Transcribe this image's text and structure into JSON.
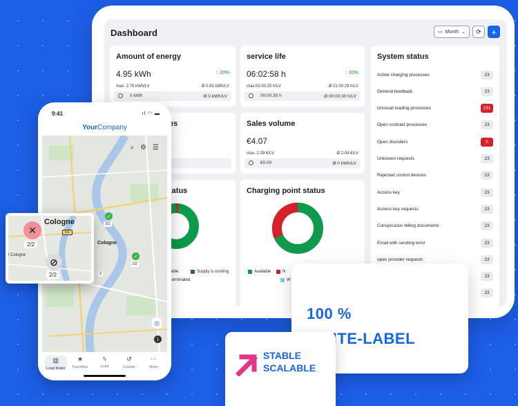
{
  "dashboard": {
    "title": "Dashboard",
    "period_label": "Month",
    "cards": {
      "energy": {
        "title": "Amount of energy",
        "value": "4.95 kWh",
        "delta": "↑ 20%",
        "max": "max. 2.76 kWh/LV",
        "avg": "Ø 0.83 kWh/LV",
        "foot_left": "0 kWh",
        "foot_right": "Ø 0 kWh/LV"
      },
      "service": {
        "title": "service life",
        "value": "06:02:58 h",
        "delta": "↑ 20%",
        "max": "max.03:00:25 h/LV",
        "avg": "Ø 01:00:29 h/LV",
        "foot_left": "00:00:30 h",
        "foot_right": "Ø 00:00:30 h/LV"
      },
      "sessions": {
        "title_partial": "es"
      },
      "sales": {
        "title": "Sales volume",
        "value": "€4.07",
        "max": "max. 2.09 €/LV",
        "avg": "Ø 2.04 €/LV",
        "foot_left": "€0.00",
        "foot_right": "Ø 0 kWh/LV"
      },
      "supply": {
        "title_partial": "tatus",
        "legend": [
          "able",
          "Supply is running",
          "terminated"
        ]
      },
      "charging_point": {
        "title": "Charging point status",
        "legend": [
          "Available",
          "N",
          "W"
        ]
      }
    },
    "system_status": {
      "title": "System status",
      "rows": [
        {
          "label": "Active charging processes",
          "count": "23",
          "alert": false
        },
        {
          "label": "General feedback",
          "count": "23",
          "alert": false
        },
        {
          "label": "Unusual loading processes",
          "count": "231",
          "alert": true
        },
        {
          "label": "Open contract processes",
          "count": "23",
          "alert": false
        },
        {
          "label": "Open disorders",
          "count": "5",
          "alert": true
        },
        {
          "label": "Unknown requests",
          "count": "23",
          "alert": false
        },
        {
          "label": "Rejected control devices",
          "count": "23",
          "alert": false
        },
        {
          "label": "Access key",
          "count": "23",
          "alert": false
        },
        {
          "label": "Access key requests",
          "count": "23",
          "alert": false
        },
        {
          "label": "Conspicuous billing documents",
          "count": "23",
          "alert": false
        },
        {
          "label": "Email with sending error",
          "count": "23",
          "alert": false
        },
        {
          "label": "open provider requests",
          "count": "23",
          "alert": false
        },
        {
          "label": "",
          "count": "23",
          "alert": false
        },
        {
          "label": "",
          "count": "23",
          "alert": false
        }
      ]
    }
  },
  "phone": {
    "time": "9:41",
    "brand_bold": "Your",
    "brand_rest": "Company",
    "map_labels": [
      "2/2",
      "2/2",
      "2",
      "Cologne"
    ],
    "nav": [
      "Load finder",
      "Favorites",
      "Load",
      "Courier",
      "More"
    ]
  },
  "zoom": {
    "city": "Cologne",
    "side_label": "l Cologne",
    "badge_top": "51",
    "pin1_label": "2/2",
    "pin2_label": "2/2"
  },
  "badges": {
    "white_label_1": "100 %",
    "white_label_2": "WHITE-LABEL",
    "stable": "STABLE",
    "scalable": "SCALABLE"
  },
  "colors": {
    "accent": "#1565e8",
    "background": "#1d5ee6",
    "green": "#0f9a4b",
    "red": "#d6202b",
    "blue_dark": "#1f5fa8",
    "blue_light": "#8fc3ea"
  }
}
